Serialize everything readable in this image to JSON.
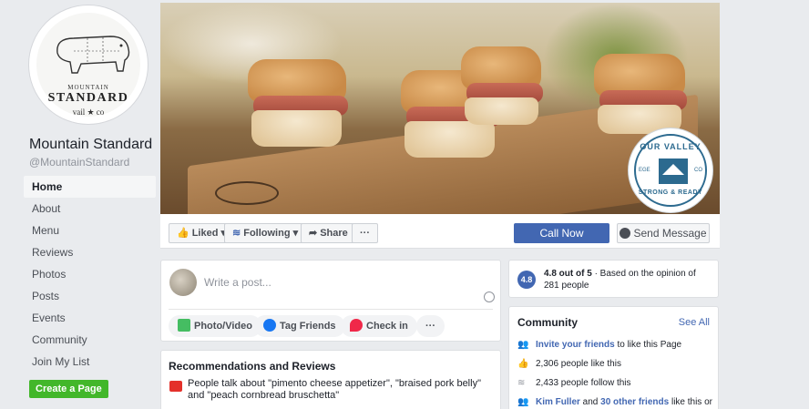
{
  "logo": {
    "line1": "MOUNTAIN",
    "line2": "STANDARD",
    "line3": "vail ★ co"
  },
  "page": {
    "name": "Mountain Standard",
    "handle": "@MountainStandard"
  },
  "nav": [
    "Home",
    "About",
    "Menu",
    "Reviews",
    "Photos",
    "Posts",
    "Events",
    "Community",
    "Join My List"
  ],
  "create_page": "Create a Page",
  "badge": {
    "top": "OUR VALLEY",
    "bottom": "STRONG & READY",
    "left": "EGE",
    "right": "CO"
  },
  "actions": {
    "liked": "Liked",
    "following": "Following",
    "share": "Share",
    "more": "···",
    "call_now": "Call Now",
    "send_message": "Send Message"
  },
  "composer": {
    "placeholder": "Write a post...",
    "photo_video": "Photo/Video",
    "tag_friends": "Tag Friends",
    "check_in": "Check in",
    "more": "···"
  },
  "recommendations": {
    "title": "Recommendations and Reviews",
    "text": "People talk about \"pimento cheese appetizer\", \"braised pork belly\" and \"peach cornbread bruschetta\""
  },
  "rating": {
    "score": "4.8",
    "headline": "4.8 out of 5",
    "detail": " · Based on the opinion of 281 people"
  },
  "community": {
    "title": "Community",
    "see_all": "See All",
    "invite_link": "Invite your friends",
    "invite_rest": " to like this Page",
    "likes": "2,306 people like this",
    "follows": "2,433 people follow this",
    "friend_name": "Kim Fuller",
    "friends_and": " and ",
    "friends_others": "30 other friends",
    "friends_rest": " like this or"
  }
}
